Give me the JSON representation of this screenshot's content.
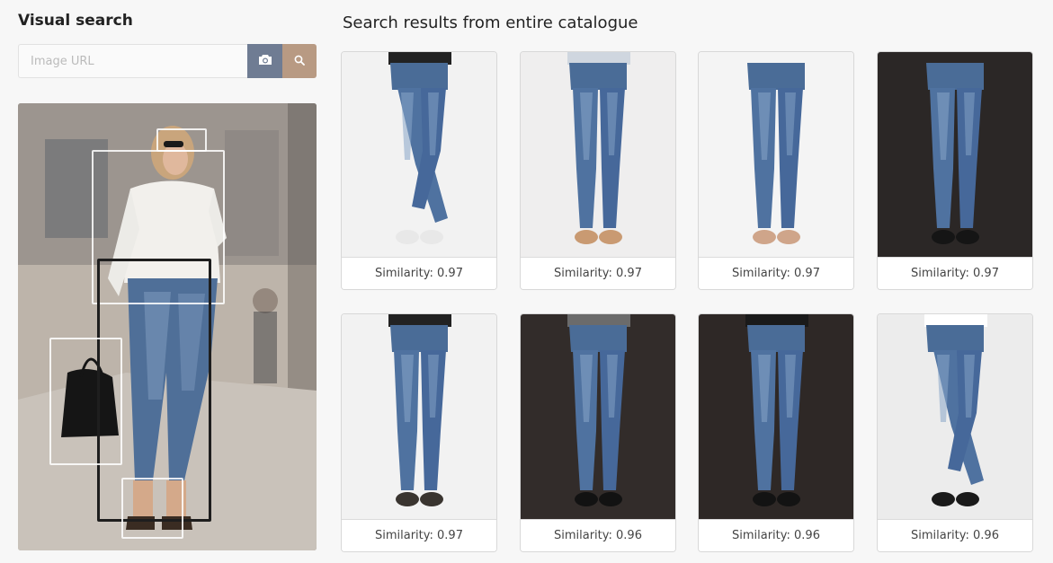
{
  "panel": {
    "title": "Visual search",
    "url_placeholder": "Image URL",
    "url_value": "",
    "camera_icon": "camera-icon",
    "search_icon": "search-icon"
  },
  "results": {
    "title": "Search results from entire catalogue",
    "items": [
      {
        "caption": "Similarity: 0.97",
        "bg": "#f2f2f2",
        "legs": "cross",
        "top": "#222222",
        "shoes": "#e8e8e8"
      },
      {
        "caption": "Similarity: 0.97",
        "bg": "#efeeee",
        "legs": "straight",
        "top": "#cfd6df",
        "shoes": "#c99a72"
      },
      {
        "caption": "Similarity: 0.97",
        "bg": "#f4f4f4",
        "legs": "straight",
        "top": "#f4f4f4",
        "shoes": "#cfa58a"
      },
      {
        "caption": "Similarity: 0.97",
        "bg": "#2b2726",
        "legs": "straight",
        "top": "#2b2726",
        "shoes": "#151515"
      },
      {
        "caption": "Similarity: 0.97",
        "bg": "#f2f2f2",
        "legs": "straight",
        "top": "#222222",
        "shoes": "#3a3530"
      },
      {
        "caption": "Similarity: 0.96",
        "bg": "#322c2a",
        "legs": "straight",
        "top": "#6b6b6b",
        "shoes": "#121212"
      },
      {
        "caption": "Similarity: 0.96",
        "bg": "#2e2826",
        "legs": "straight",
        "top": "#1a1a1a",
        "shoes": "#131313"
      },
      {
        "caption": "Similarity: 0.96",
        "bg": "#ececec",
        "legs": "cross",
        "top": "#ffffff",
        "shoes": "#1a1a1a"
      }
    ]
  }
}
